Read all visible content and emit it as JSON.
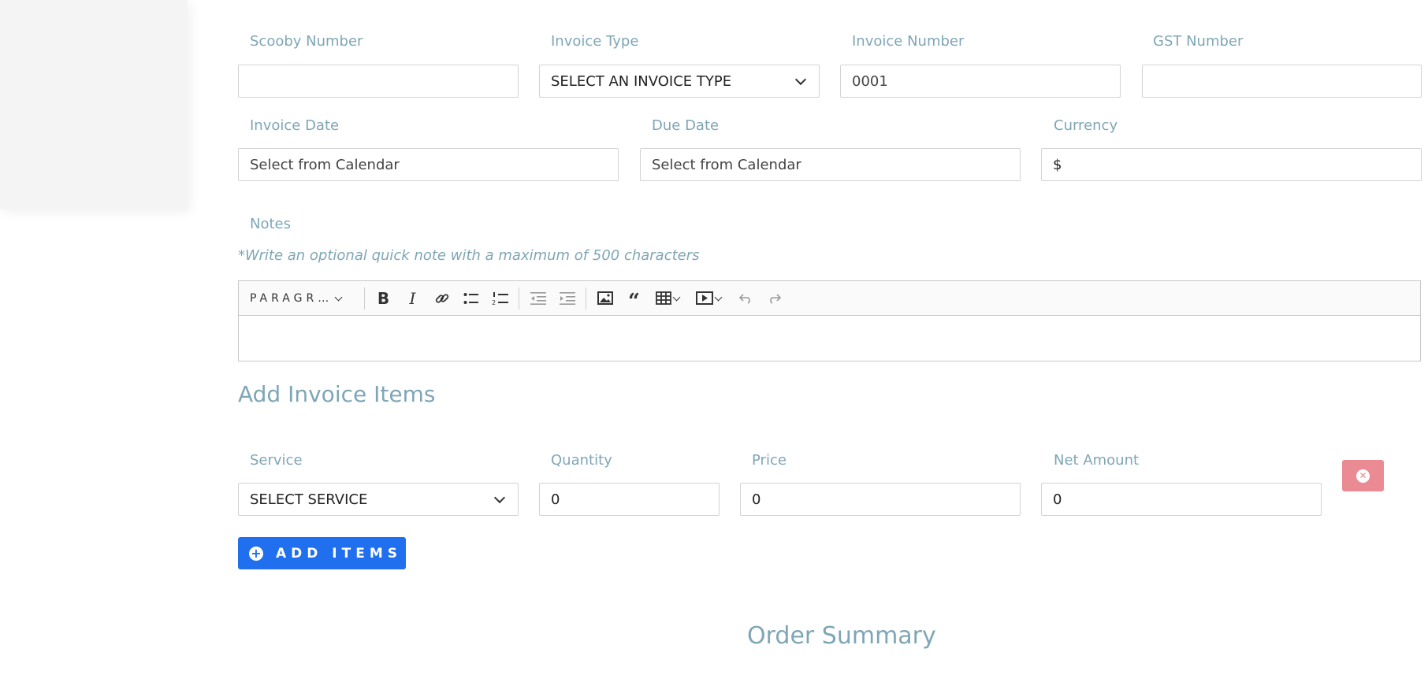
{
  "invoice_row": {
    "scooby_label": "Scooby Number",
    "scooby_value": "",
    "type_label": "Invoice Type",
    "type_value": "SELECT AN INVOICE TYPE",
    "number_label": "Invoice Number",
    "number_value": "0001",
    "gst_label": "GST Number",
    "gst_value": ""
  },
  "date_row": {
    "invoice_date_label": "Invoice Date",
    "invoice_date_placeholder": "Select from Calendar",
    "due_date_label": "Due Date",
    "due_date_placeholder": "Select from Calendar",
    "currency_label": "Currency",
    "currency_value": "$"
  },
  "notes": {
    "label": "Notes",
    "hint": "*Write an optional quick note with a maximum of 500 characters",
    "toolbar": {
      "heading_label": "PARAGR…",
      "icons": [
        "bold-icon",
        "italic-icon",
        "link-icon",
        "bulleted-list-icon",
        "numbered-list-icon",
        "outdent-icon",
        "indent-icon",
        "image-icon",
        "blockquote-icon",
        "table-icon",
        "media-icon",
        "undo-icon",
        "redo-icon"
      ]
    },
    "content": ""
  },
  "items_section": {
    "title": "Add Invoice Items",
    "service_label": "Service",
    "service_value": "SELECT SERVICE",
    "quantity_label": "Quantity",
    "quantity_value": "0",
    "price_label": "Price",
    "price_value": "0",
    "net_label": "Net Amount",
    "net_value": "0",
    "add_button_label": "ADD ITEMS"
  },
  "summary": {
    "title": "Order Summary"
  },
  "colors": {
    "label": "#7fa6b6",
    "primary": "#1f6fef",
    "danger": "#ea8a92"
  }
}
